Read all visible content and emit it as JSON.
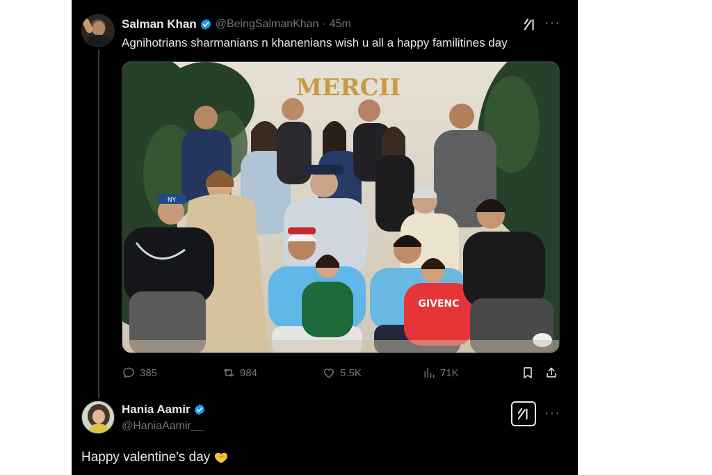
{
  "post": {
    "author_name": "Salman Khan",
    "author_handle": "@BeingSalmanKhan",
    "separator": "·",
    "time": "45m",
    "text": "Agnihotrians sharmanians n khanenians wish u all a happy familitines day",
    "photo_sign_text": "MERCII",
    "shirt_print_text": "GIVENC",
    "cap_logo_text": "NY",
    "stats": {
      "replies": "385",
      "reposts": "984",
      "likes": "5.5K",
      "views": "71K"
    }
  },
  "reply": {
    "author_name": "Hania Aamir",
    "author_handle": "@HaniaAamir__",
    "text": "Happy valentine's day",
    "emoji": "heart-hands-icon"
  },
  "icons": {
    "verified": "verified-badge-icon",
    "grok": "grok-icon",
    "more": "more-icon",
    "reply": "reply-icon",
    "repost": "repost-icon",
    "like": "like-icon",
    "views": "views-icon",
    "bookmark": "bookmark-icon",
    "share": "share-icon"
  },
  "colors": {
    "background": "#000000",
    "text_primary": "#e7e9ea",
    "text_secondary": "#71767b",
    "verified_blue": "#1d9bf0",
    "emoji_yellow": "#f5c542"
  }
}
